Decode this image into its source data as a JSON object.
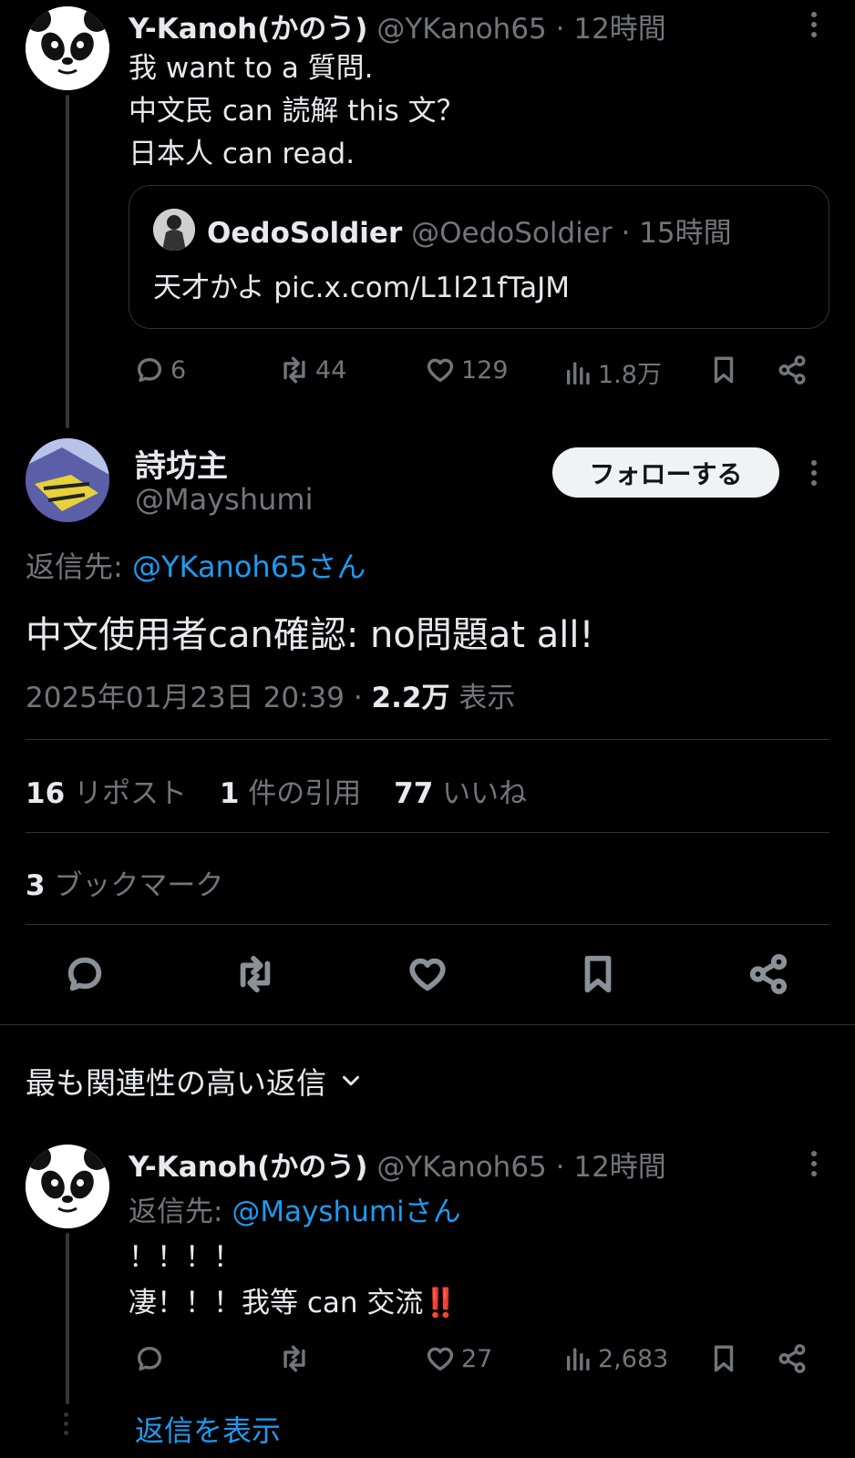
{
  "tweet1": {
    "display_name": "Y-Kanoh(かのう)",
    "handle": "@YKanoh65",
    "time": "· 12時間",
    "lines": [
      "我 want to a 質問.",
      "中文民 can 読解 this 文？",
      "日本人 can read."
    ],
    "quote": {
      "display_name": "OedoSoldier",
      "handle": "@OedoSoldier",
      "time": "· 15時間",
      "text": "天才かよ pic.x.com/L1l21fTaJM"
    },
    "actions": {
      "replies": "6",
      "reposts": "44",
      "likes": "129",
      "views": "1.8万"
    }
  },
  "main_tweet": {
    "display_name": "詩坊主",
    "handle": "@Mayshumi",
    "follow_label": "フォローする",
    "reply_to_prefix": "返信先: ",
    "reply_to_user": "@YKanoh65さん",
    "text": "中文使用者can確認: no問題at all!",
    "timestamp": "2025年01月23日 20:39 · ",
    "views_count": "2.2万",
    "views_label": " 表示",
    "stats": {
      "reposts_count": "16",
      "reposts_label": " リポスト",
      "quotes_count": "1",
      "quotes_label": " 件の引用",
      "likes_count": "77",
      "likes_label": " いいね",
      "bookmarks_count": "3",
      "bookmarks_label": " ブックマーク"
    }
  },
  "replies_sort": {
    "label": "最も関連性の高い返信"
  },
  "reply1": {
    "display_name": "Y-Kanoh(かのう)",
    "handle": "@YKanoh65",
    "time": "· 12時間",
    "reply_to_prefix": "返信先: ",
    "reply_to_user": "@Mayshumiさん",
    "lines": [
      "！！！！",
      "凄！！！我等 can 交流‼️"
    ],
    "actions": {
      "replies": "",
      "reposts": "",
      "likes": "27",
      "views": "2,683"
    }
  },
  "show_replies": {
    "label": "返信を表示"
  },
  "colors": {
    "background": "#000000",
    "text": "#e7e9ea",
    "muted": "#71767b",
    "link": "#1d9bf0",
    "divider": "#2f3336"
  }
}
